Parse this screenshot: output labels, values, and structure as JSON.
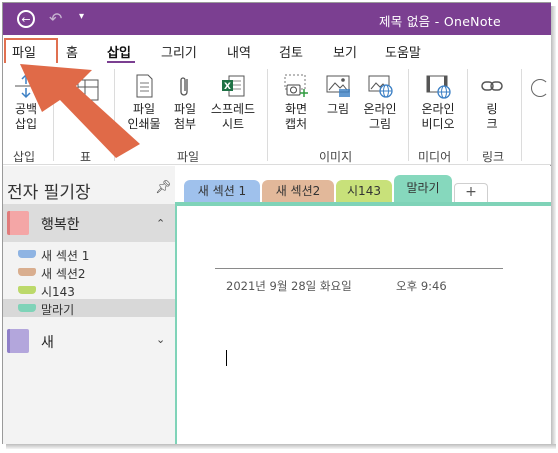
{
  "titlebar": {
    "title": "제목 없음 - OneNote",
    "accent_color": "#7b3f91",
    "icons": [
      "back-icon",
      "undo-icon",
      "quick-access-icon"
    ]
  },
  "menu": {
    "tabs": [
      "파일",
      "홈",
      "삽입",
      "그리기",
      "내역",
      "검토",
      "보기",
      "도움말"
    ],
    "active": "삽입"
  },
  "ribbon": {
    "buttons": {
      "insert_space": "공백\n삽입",
      "file_printout": "파일\n인쇄물",
      "file_attach": "파일\n첨부",
      "spreadsheet": "스프레드\n시트",
      "screen_clipping": "화면\n캡처",
      "pictures": "그림",
      "online_pictures": "온라인\n그림",
      "online_video": "온라인\n비디오",
      "link": "링\n크"
    },
    "groups": {
      "insert": "삽입",
      "table": "표",
      "files": "파일",
      "images": "이미지",
      "media": "미디어",
      "links": "링크"
    }
  },
  "sidebar": {
    "title": "전자 필기장",
    "notebooks": [
      {
        "name": "행복한",
        "color": "#f4a6a6",
        "expanded": true,
        "sections": [
          {
            "name": "새 섹션 1",
            "color": "#8fb4e3"
          },
          {
            "name": "새 섹션2",
            "color": "#d9ae8f"
          },
          {
            "name": "시143",
            "color": "#bcd96a"
          },
          {
            "name": "말라기",
            "color": "#7fd3b8",
            "selected": true
          }
        ]
      },
      {
        "name": "새",
        "color": "#b3a6dc",
        "expanded": false,
        "sections": []
      }
    ]
  },
  "section_tabs": [
    {
      "name": "새 섹션 1",
      "color": "#9fc1ec"
    },
    {
      "name": "새 섹션2",
      "color": "#e2b89a"
    },
    {
      "name": "시143",
      "color": "#c8e17a"
    },
    {
      "name": "말라기",
      "color": "#86d8bd",
      "active": true
    }
  ],
  "add_tab_label": "+",
  "page": {
    "date": "2021년 9월 28일 화요일",
    "time": "오후 9:46"
  }
}
